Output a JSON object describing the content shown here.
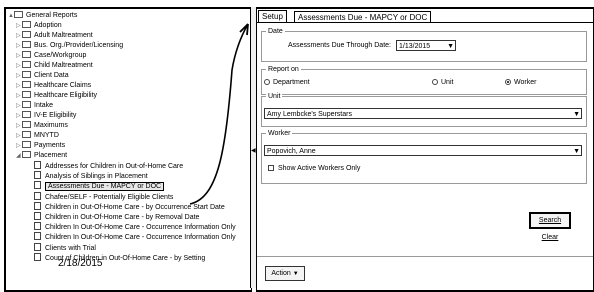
{
  "tree": {
    "root": "General Reports",
    "items": [
      "Adoption",
      "Adult Maltreatment",
      "Bus. Org./Provider/Licensing",
      "Case/Workgroup",
      "Child Maltreatment",
      "Client Data",
      "Healthcare Claims",
      "Healthcare Eligibility",
      "Intake",
      "IV-E Eligibility",
      "Maximums",
      "MNYTD",
      "Payments",
      "Placement"
    ],
    "placement_children": [
      "Addresses for Children in Out-of-Home Care",
      "Analysis of Siblings in Placement",
      "Assessments Due - MAPCY or DOC",
      "Chafee/SELF - Potentially Eligible Clients",
      "Children in Out-Of-Home Care - by Occurrence Start Date",
      "Children in Out-Of-Home Care - by Removal Date",
      "Children In Out-Of-Home Care - Occurrence Information Only",
      "Children In Out-Of-Home Care - Occurrence Information Only",
      "Clients with Trial",
      "Count of Children in Out-Of-Home Care - by Setting"
    ]
  },
  "stamp": "2/18/2015",
  "tabs": [
    "Setup",
    "Assessments Due - MAPCY or DOC"
  ],
  "date_group": {
    "label": "Date",
    "field_label": "Assessments Due Through Date:",
    "value": "1/13/2015"
  },
  "report_on": {
    "label": "Report on",
    "options": [
      "Department",
      "Unit",
      "Worker"
    ],
    "selected": "Worker"
  },
  "unit": {
    "label": "Unit",
    "value": "Amy Lembcke's Superstars"
  },
  "worker": {
    "label": "Worker",
    "value": "Popovich, Anne",
    "checkbox_label": "Show Active Workers Only"
  },
  "buttons": {
    "search": "Search",
    "clear": "Clear",
    "action": "Action"
  }
}
